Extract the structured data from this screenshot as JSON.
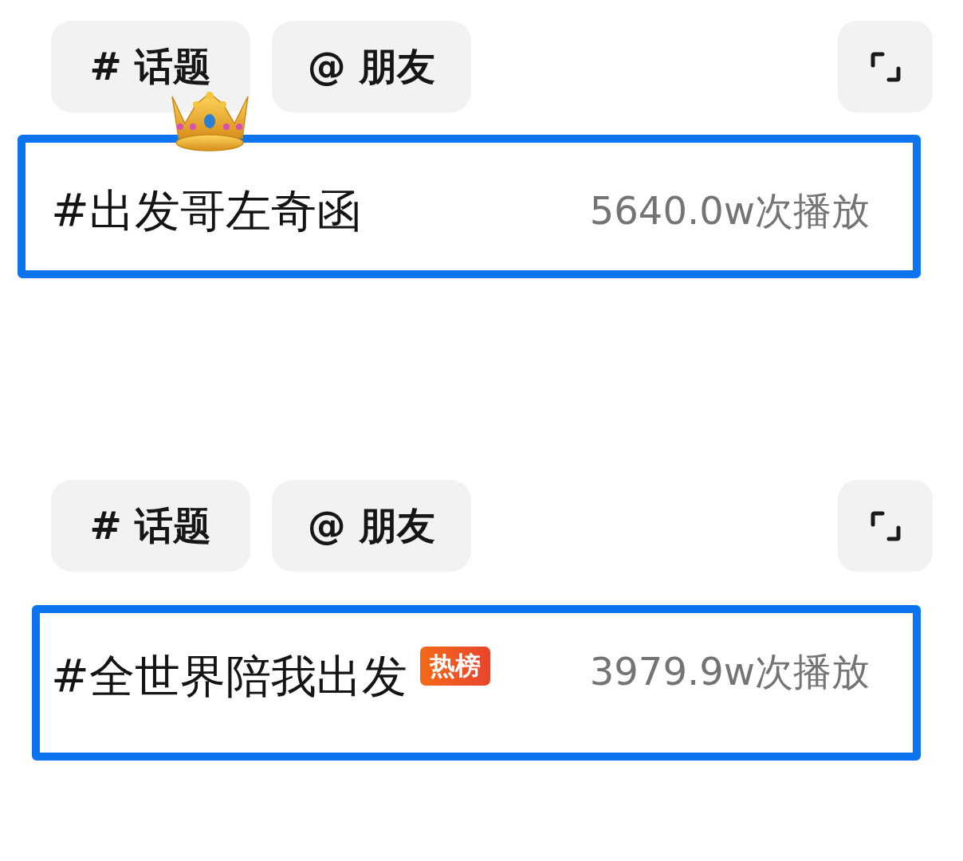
{
  "panels": [
    {
      "chips": [
        {
          "label": "# 话题"
        },
        {
          "label": "@ 朋友"
        }
      ],
      "crown": true,
      "topic": {
        "title": "#出发哥左奇函",
        "plays": "5640.0w次播放",
        "highlighted": true
      }
    },
    {
      "chips": [
        {
          "label": "# 话题"
        },
        {
          "label": "@ 朋友"
        }
      ],
      "crown": false,
      "topic": {
        "title": "#全世界陪我出发",
        "badge": "热榜",
        "plays": "3979.9w次播放",
        "highlighted": true
      }
    }
  ]
}
